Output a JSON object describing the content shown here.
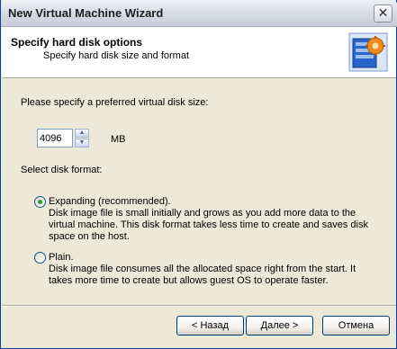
{
  "window": {
    "title": "New Virtual Machine Wizard",
    "close_symbol": "✕"
  },
  "header": {
    "title": "Specify hard disk options",
    "subtitle": "Specify hard disk size and format",
    "icon": "disk-settings-icon"
  },
  "size": {
    "label": "Please specify a preferred virtual disk size:",
    "value": "4096",
    "unit": "MB"
  },
  "format": {
    "label": "Select disk format:",
    "options": [
      {
        "label": "Expanding (recommended).",
        "selected": true,
        "description": "Disk image file is small initially and grows as you add more data to the virtual machine. This disk format takes less time to create and saves disk space on the host."
      },
      {
        "label": "Plain.",
        "selected": false,
        "description": "Disk image file consumes all the allocated space right from the start. It takes more time to create but allows guest OS to operate faster."
      }
    ]
  },
  "buttons": {
    "back": "< Назад",
    "next": "Далее >",
    "cancel": "Отмена"
  },
  "colors": {
    "dialog_bg": "#ece9d8",
    "radio_dot": "#21a121",
    "icon_blue": "#2a63c9",
    "icon_orange": "#f08a1c"
  }
}
